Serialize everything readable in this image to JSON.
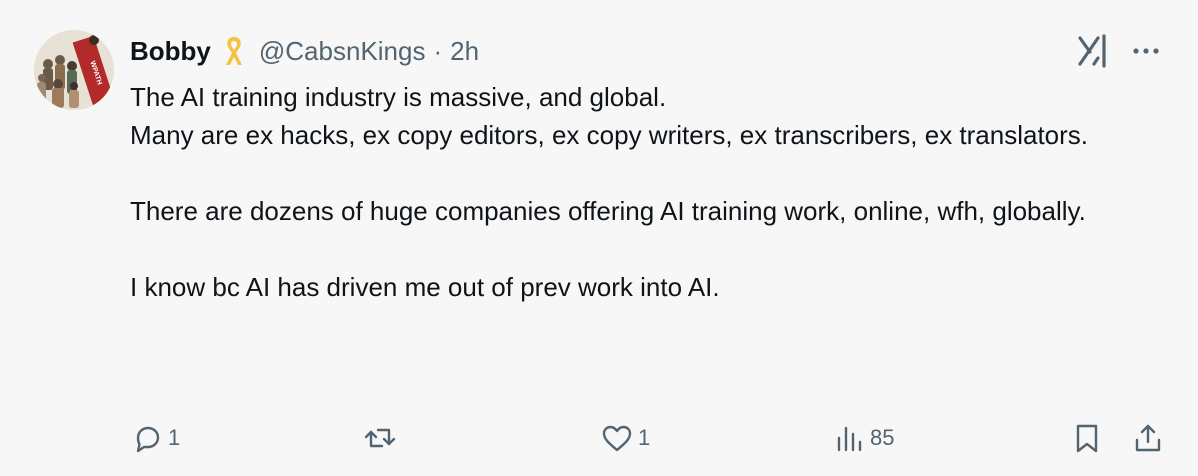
{
  "tweet": {
    "author_name": "Bobby",
    "author_badge_icon": "yellow-ribbon-icon",
    "handle": "@CabsnKings",
    "separator": "·",
    "time": "2h",
    "avatar_text": "WPATH",
    "paragraphs": [
      "The AI training industry is massive, and global.",
      "Many are ex hacks, ex copy editors, ex copy writers, ex transcribers, ex translators.",
      "There are dozens of huge companies offering AI training work, online, wfh, globally.",
      "I know bc AI has driven me out of prev work into AI."
    ]
  },
  "actions": {
    "replies": "1",
    "reposts": "",
    "likes": "1",
    "views": "85"
  },
  "colors": {
    "background": "#f7f7f7",
    "text": "#0f1419",
    "muted": "#536471",
    "ribbon": "#f5c242"
  }
}
